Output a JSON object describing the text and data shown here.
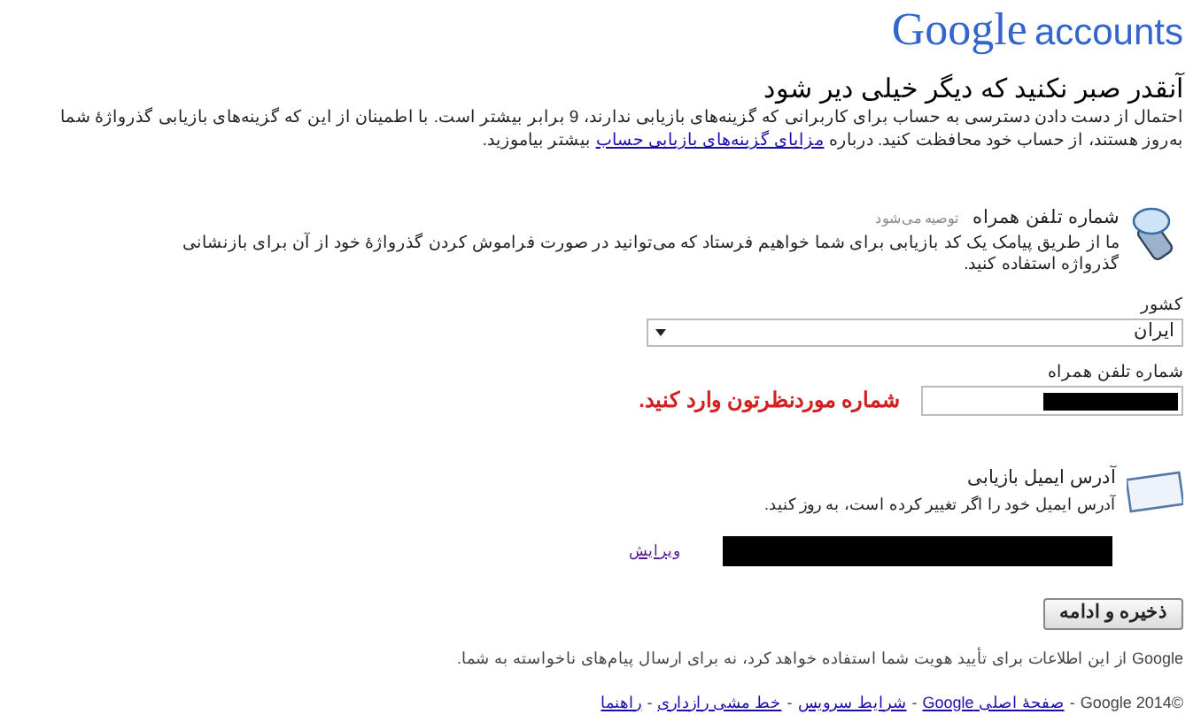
{
  "header": {
    "logo": "Google",
    "product": "accounts"
  },
  "intro": {
    "heading": "آنقدر صبر نکنید که دیگر خیلی دیر شود",
    "text": "احتمال از دست دادن دسترسی به حساب برای کاربرانی که گزینه‌های بازیابی ندارند، 9 برابر بیشتر است. با اطمینان از این که گزینه‌های بازیابی گذرواژهٔ شما بەروز هستند، از حساب خود محافظت کنید. درباره",
    "link": "مزایای گزینه‌های بازیابی حساب",
    "text_end": "بیشتر بیاموزید."
  },
  "phone": {
    "title": "شماره تلفن همراه",
    "tag": "توصیه می‌شود",
    "description": "ما از طریق پیامک یک کد بازیابی برای شما خواهیم فرستاد که می‌توانید در صورت فراموش کردن گذرواژهٔ خود از آن برای بازنشانی گذرواژه استفاده کنید.",
    "country_label": "کشور",
    "country_value": "ایران",
    "number_label": "شماره تلفن همراه",
    "annotation": "شماره موردنظرتون وارد کنید."
  },
  "email": {
    "title": "آدرس ایمیل بازیابی",
    "description": "آدرس ایمیل خود را اگر تغییر کرده است، به روز کنید.",
    "edit_link": "ویرایش"
  },
  "save_button": "ذخیره و ادامه",
  "note": "Google از این اطلاعات برای تأیید هویت شما استفاده خواهد کرد، نه برای ارسال پیام‌های ناخواسته به شما.",
  "footer": {
    "copyright": "©Google 2014",
    "separator": "-",
    "links": [
      "صفحهٔ اصلی Google",
      "شرایط سرویس",
      "خط مشی رازداری",
      "راهنما"
    ]
  }
}
